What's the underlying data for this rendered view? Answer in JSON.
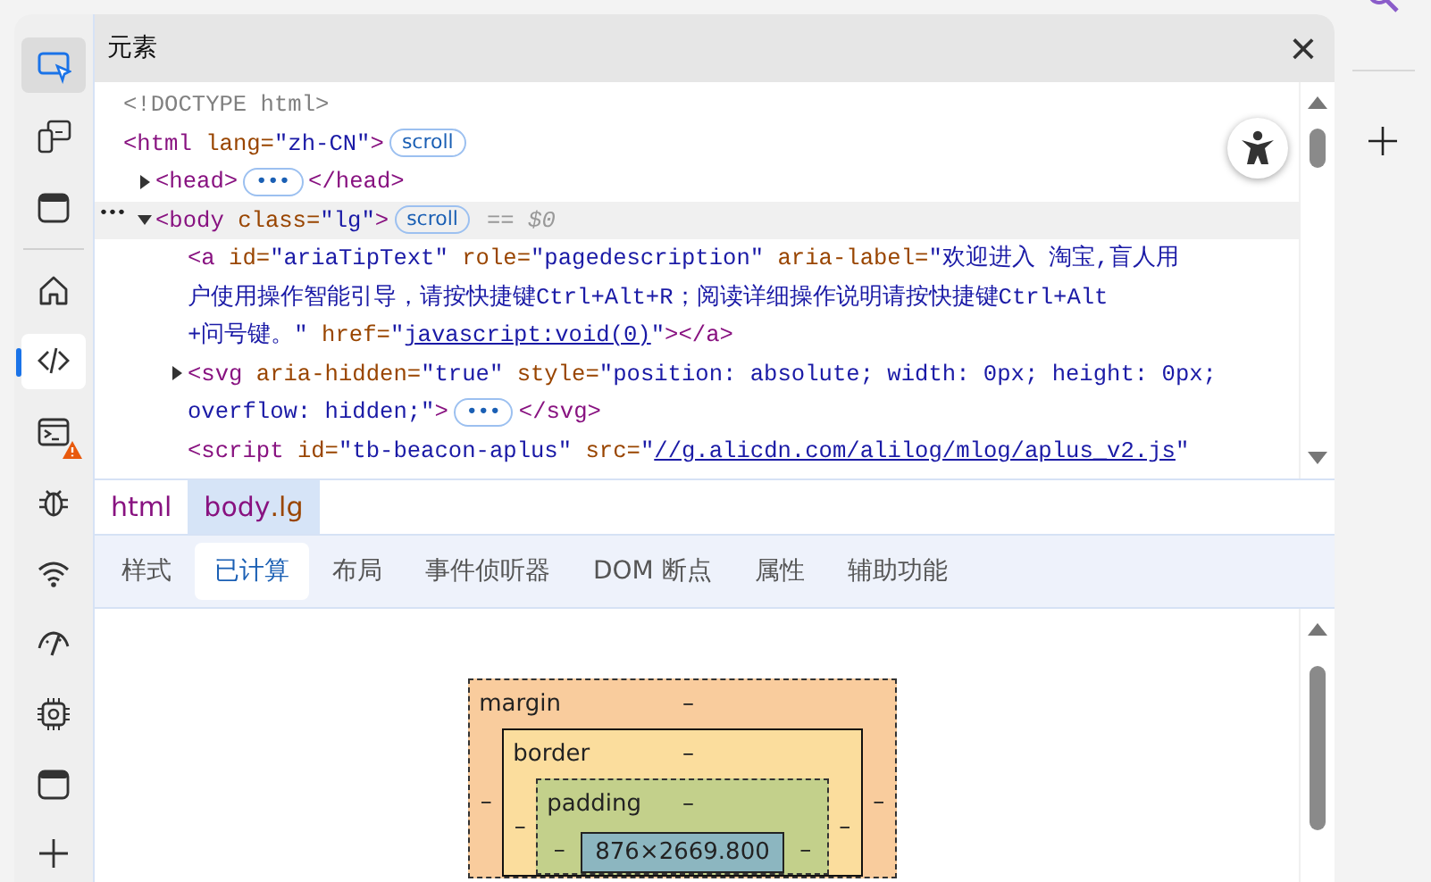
{
  "window": {
    "title": "元素",
    "close": "×"
  },
  "sidebar": {
    "inspect": {
      "on": true
    },
    "top_tools": [
      {
        "kind": "device",
        "selected": false
      },
      {
        "kind": "dock",
        "selected": false
      }
    ],
    "tools": [
      {
        "kind": "home",
        "selected": false
      },
      {
        "kind": "code",
        "selected": true
      },
      {
        "kind": "console",
        "selected": false,
        "warning": true
      },
      {
        "kind": "bug",
        "selected": false
      },
      {
        "kind": "wifi",
        "selected": false
      },
      {
        "kind": "gauge",
        "selected": false
      },
      {
        "kind": "chip",
        "selected": false
      },
      {
        "kind": "dock",
        "selected": false
      },
      {
        "kind": "plus",
        "selected": false
      }
    ]
  },
  "dom_tree": [
    {
      "selected": false,
      "lines": [
        [
          {
            "kind": "doctype",
            "text": "<!DOCTYPE html>"
          }
        ]
      ]
    },
    {
      "selected": false,
      "lines": [
        [
          {
            "kind": "tag",
            "text": "<html"
          },
          {
            "kind": "attr",
            "text": " lang="
          },
          {
            "kind": "value",
            "text": "\"zh-CN\""
          },
          {
            "kind": "tag",
            "text": ">"
          },
          {
            "kind": "badge",
            "text": "scroll"
          }
        ]
      ],
      "children": [
        {
          "selected": false,
          "expanded": false,
          "lines": [
            [
              {
                "kind": "tag",
                "text": "<head>"
              },
              {
                "kind": "badge",
                "text": "•••"
              },
              {
                "kind": "tag",
                "text": "</head>"
              }
            ]
          ]
        },
        {
          "selected": true,
          "expanded": true,
          "gutter": "•••",
          "lines": [
            [
              {
                "kind": "tag",
                "text": "<body"
              },
              {
                "kind": "attr",
                "text": " class="
              },
              {
                "kind": "value",
                "text": "\"lg\""
              },
              {
                "kind": "tag",
                "text": ">"
              },
              {
                "kind": "badge",
                "text": "scroll"
              },
              {
                "kind": "hint",
                "text": "== $0"
              }
            ]
          ],
          "children": [
            {
              "selected": false,
              "lines": [
                [
                  {
                    "kind": "tag",
                    "text": "<a"
                  },
                  {
                    "kind": "attr",
                    "text": " id="
                  },
                  {
                    "kind": "value",
                    "text": "\"ariaTipText\""
                  },
                  {
                    "kind": "attr",
                    "text": " role="
                  },
                  {
                    "kind": "value",
                    "text": "\"pagedescription\""
                  },
                  {
                    "kind": "attr",
                    "text": " aria-label="
                  },
                  {
                    "kind": "value",
                    "text": "\"欢迎进入 淘宝,盲人用"
                  }
                ],
                [
                  {
                    "kind": "value",
                    "text": "户使用操作智能引导，请按快捷键Ctrl+Alt+R；阅读详细操作说明请按快捷键Ctrl+Alt"
                  }
                ],
                [
                  {
                    "kind": "value",
                    "text": "+问号键。\""
                  },
                  {
                    "kind": "attr",
                    "text": " href="
                  },
                  {
                    "kind": "value",
                    "text": "\""
                  },
                  {
                    "kind": "link",
                    "text": "javascript:void(0)"
                  },
                  {
                    "kind": "value",
                    "text": "\""
                  },
                  {
                    "kind": "tag",
                    "text": "></a>"
                  }
                ]
              ]
            },
            {
              "selected": false,
              "expanded": false,
              "lines": [
                [
                  {
                    "kind": "tag",
                    "text": "<svg"
                  },
                  {
                    "kind": "attr",
                    "text": " aria-hidden="
                  },
                  {
                    "kind": "value",
                    "text": "\"true\""
                  },
                  {
                    "kind": "attr",
                    "text": " style="
                  },
                  {
                    "kind": "value",
                    "text": "\"position: absolute; width: 0px; height: 0px;"
                  }
                ],
                [
                  {
                    "kind": "value",
                    "text": "overflow: hidden;\""
                  },
                  {
                    "kind": "tag",
                    "text": ">"
                  },
                  {
                    "kind": "badge",
                    "text": "•••"
                  },
                  {
                    "kind": "tag",
                    "text": "</svg>"
                  }
                ]
              ]
            },
            {
              "selected": false,
              "lines": [
                [
                  {
                    "kind": "tag",
                    "text": "<script"
                  },
                  {
                    "kind": "attr",
                    "text": " id="
                  },
                  {
                    "kind": "value",
                    "text": "\"tb-beacon-aplus\""
                  },
                  {
                    "kind": "attr",
                    "text": " src="
                  },
                  {
                    "kind": "value",
                    "text": "\""
                  },
                  {
                    "kind": "link",
                    "text": "//g.alicdn.com/alilog/mlog/aplus_v2.js"
                  },
                  {
                    "kind": "value",
                    "text": "\""
                  }
                ]
              ]
            }
          ]
        }
      ]
    }
  ],
  "breadcrumbs": [
    {
      "tag": "html",
      "selected": false
    },
    {
      "tag": "body",
      "class": ".lg",
      "selected": true
    }
  ],
  "tabs": [
    {
      "label": "样式",
      "selected": false
    },
    {
      "label": "已计算",
      "selected": true
    },
    {
      "label": "布局",
      "selected": false
    },
    {
      "label": "事件侦听器",
      "selected": false
    },
    {
      "label": "DOM 断点",
      "selected": false
    },
    {
      "label": "属性",
      "selected": false
    },
    {
      "label": "辅助功能",
      "selected": false
    }
  ],
  "box_model": {
    "margin": {
      "label": "margin",
      "top": "–",
      "left": "–",
      "right": "–"
    },
    "border": {
      "label": "border",
      "top": "–",
      "left": "–",
      "right": "–"
    },
    "padding": {
      "label": "padding",
      "top": "–",
      "left": "–",
      "right": "–"
    },
    "content": "876×2669.800"
  }
}
